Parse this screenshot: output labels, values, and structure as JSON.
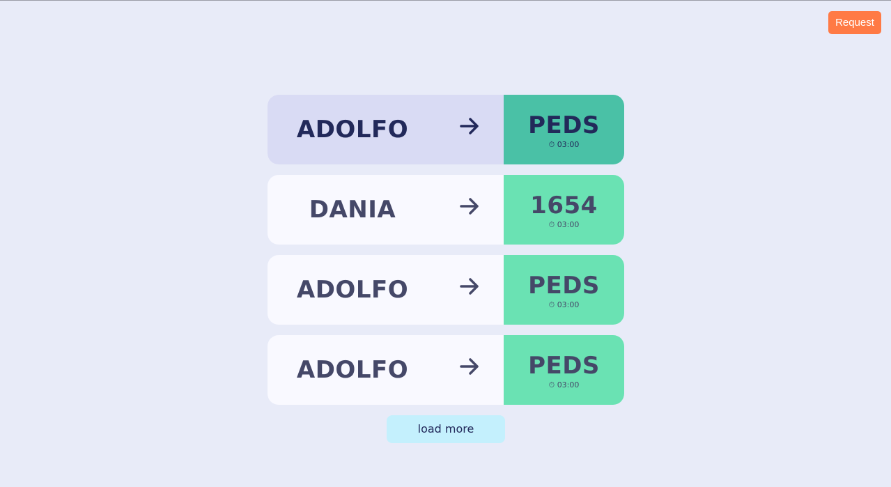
{
  "header": {
    "request_label": "Request"
  },
  "transfers": [
    {
      "name": "ADOLFO",
      "destination": "PEDS",
      "time_icon": "⏱",
      "time": "03:00",
      "selected": true
    },
    {
      "name": "DANIA",
      "destination": "1654",
      "time_icon": "⏱",
      "time": "03:00",
      "selected": false
    },
    {
      "name": "ADOLFO",
      "destination": "PEDS",
      "time_icon": "⏱",
      "time": "03:00",
      "selected": false
    },
    {
      "name": "ADOLFO",
      "destination": "PEDS",
      "time_icon": "⏱",
      "time": "03:00",
      "selected": false
    }
  ],
  "footer": {
    "load_more_label": "load more"
  },
  "colors": {
    "background": "#e8ebf8",
    "request_button": "#ff7a45",
    "card_left": "#f9f9ff",
    "card_left_selected": "#d9dbf4",
    "card_right": "#6ae2b3",
    "card_right_selected": "#4ac1a6",
    "text": "#454868",
    "text_selected": "#22295a",
    "load_more": "#c4f0fd"
  },
  "icons": {
    "arrow": "arrow-right-icon",
    "timer": "stopwatch-icon"
  }
}
